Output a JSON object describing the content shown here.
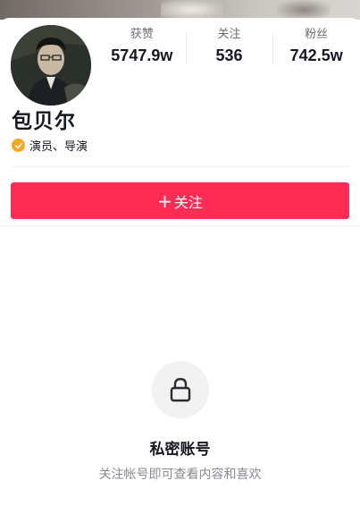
{
  "profile": {
    "name": "包贝尔",
    "verification": "演员、导演",
    "colors": {
      "accent": "#fe2c55",
      "verify_badge": "#f5a623"
    }
  },
  "stats": [
    {
      "label": "获赞",
      "value": "5747.9w"
    },
    {
      "label": "关注",
      "value": "536"
    },
    {
      "label": "粉丝",
      "value": "742.5w"
    }
  ],
  "actions": {
    "follow_plus": "+",
    "follow_label": "关注"
  },
  "privacy": {
    "icon": "lock-icon",
    "title": "私密账号",
    "description": "关注帐号即可查看内容和喜欢"
  }
}
